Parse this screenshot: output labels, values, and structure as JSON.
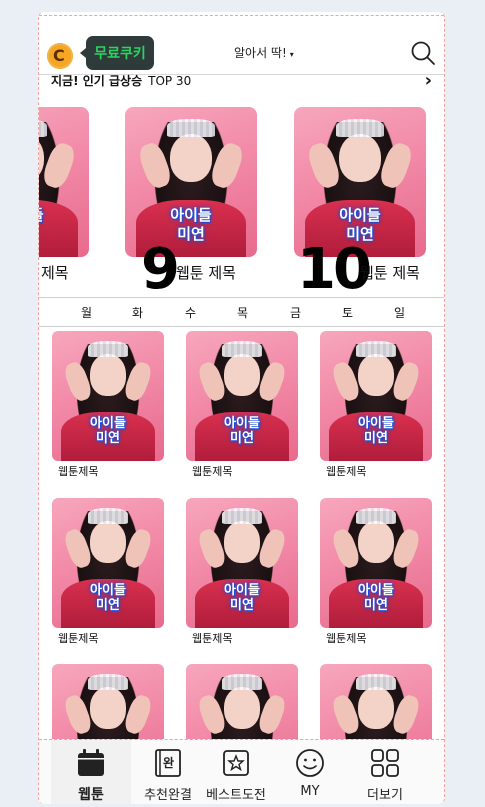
{
  "header": {
    "coin_letter": "C",
    "free_cookie_label": "무료쿠키",
    "sort_label": "알아서 딱!",
    "sort_caret": "▾"
  },
  "trending": {
    "title": "지금! 인기 급상승",
    "top_label": "TOP 30",
    "arrow": "›",
    "items": [
      {
        "rank": "",
        "title": "제목",
        "caption_line1": "아이들",
        "caption_line2": "미연"
      },
      {
        "rank": "9",
        "title": "웹툰 제목",
        "caption_line1": "아이들",
        "caption_line2": "미연"
      },
      {
        "rank": "10",
        "title": "웹툰 제목",
        "caption_line1": "아이들",
        "caption_line2": "미연"
      }
    ]
  },
  "days": [
    "월",
    "화",
    "수",
    "목",
    "금",
    "토",
    "일"
  ],
  "grid": {
    "items": [
      {
        "title": "웹툰제목",
        "caption_line1": "아이들",
        "caption_line2": "미연"
      },
      {
        "title": "웹툰제목",
        "caption_line1": "아이들",
        "caption_line2": "미연"
      },
      {
        "title": "웹툰제목",
        "caption_line1": "아이들",
        "caption_line2": "미연"
      },
      {
        "title": "웹툰제목",
        "caption_line1": "아이들",
        "caption_line2": "미연"
      },
      {
        "title": "웹툰제목",
        "caption_line1": "아이들",
        "caption_line2": "미연"
      },
      {
        "title": "웹툰제목",
        "caption_line1": "아이들",
        "caption_line2": "미연"
      },
      {
        "title": "",
        "caption_line1": "",
        "caption_line2": ""
      },
      {
        "title": "",
        "caption_line1": "",
        "caption_line2": ""
      },
      {
        "title": "",
        "caption_line1": "",
        "caption_line2": ""
      }
    ]
  },
  "nav": [
    {
      "label": "웹툰",
      "icon": "calendar-icon",
      "active": true
    },
    {
      "label": "추천완결",
      "icon": "complete-book-icon",
      "icon_text": "완"
    },
    {
      "label": "베스트도전",
      "icon": "star-box-icon"
    },
    {
      "label": "MY",
      "icon": "smiley-icon"
    },
    {
      "label": "더보기",
      "icon": "grid-menu-icon"
    }
  ],
  "colors": {
    "accent_green": "#2bd55f",
    "coin_orange": "#f5a623",
    "caption_blue": "#1a4fd8"
  }
}
